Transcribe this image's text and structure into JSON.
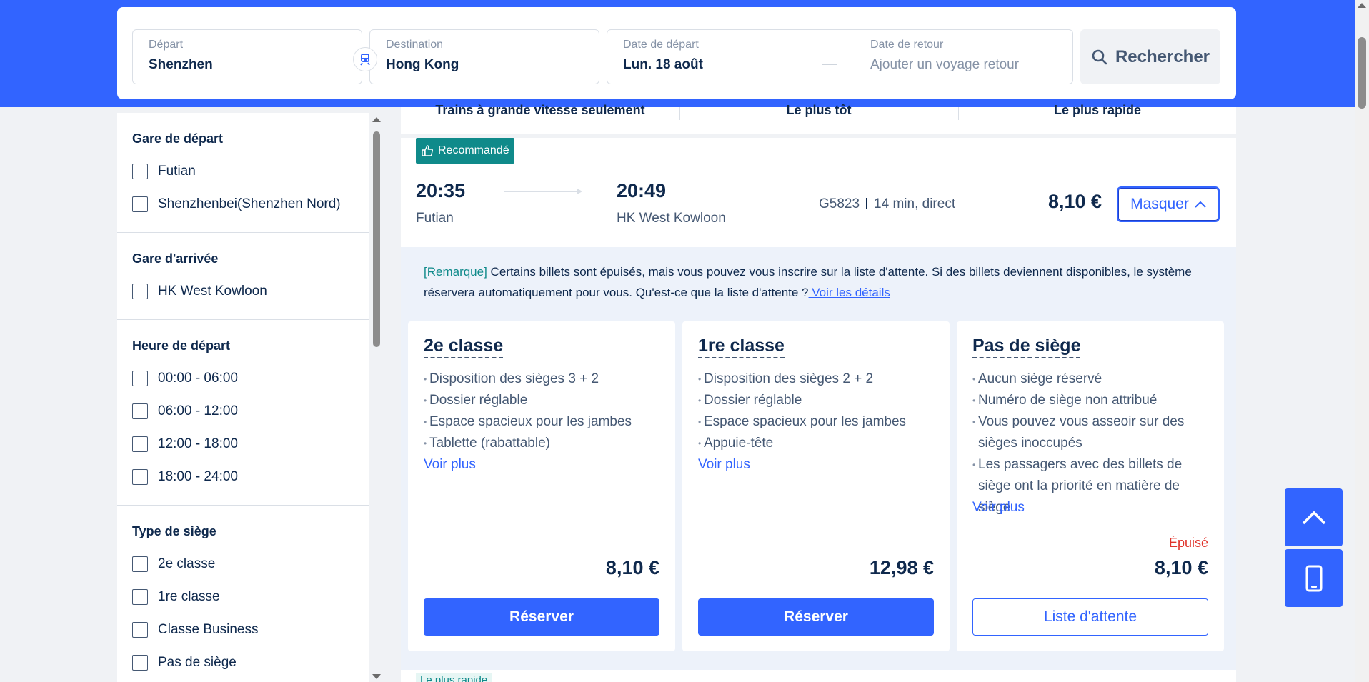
{
  "search": {
    "departure_label": "Départ",
    "departure_value": "Shenzhen",
    "destination_label": "Destination",
    "destination_value": "Hong Kong",
    "depart_date_label": "Date de départ",
    "depart_date_value": "Lun. 18 août",
    "return_date_label": "Date de retour",
    "return_date_placeholder": "Ajouter un voyage retour",
    "search_button": "Rechercher"
  },
  "sidebar": {
    "sections": [
      {
        "title": "Gare de départ",
        "options": [
          "Futian",
          "Shenzhenbei(Shenzhen Nord)"
        ]
      },
      {
        "title": "Gare d'arrivée",
        "options": [
          "HK West Kowloon"
        ]
      },
      {
        "title": "Heure de départ",
        "options": [
          "00:00 - 06:00",
          "06:00 - 12:00",
          "12:00 - 18:00",
          "18:00 - 24:00"
        ]
      },
      {
        "title": "Type de siège",
        "options": [
          "2e classe",
          "1re classe",
          "Classe Business",
          "Pas de siège"
        ]
      }
    ]
  },
  "sort": {
    "items": [
      "Trains à grande vitesse seulement",
      "Le plus tôt",
      "Le plus rapide"
    ]
  },
  "result": {
    "badge": "Recommandé",
    "dep_time": "20:35",
    "dep_station": "Futian",
    "arr_time": "20:49",
    "arr_station": "HK West Kowloon",
    "train_no": "G5823",
    "duration": "14 min, direct",
    "price": "8,10 €",
    "toggle_label": "Masquer",
    "remark_tag": "[Remarque]",
    "remark_text": " Certains billets sont épuisés, mais vous pouvez vous inscrire sur la liste d'attente. Si des billets deviennent disponibles, le système réservera automatiquement pour vous. Qu'est-ce que la liste d'attente ?",
    "remark_link": " Voir les détails",
    "classes": [
      {
        "name": "2e classe",
        "features": [
          "Disposition des sièges 3 + 2",
          "Dossier réglable",
          "Espace spacieux pour les jambes",
          "Tablette (rabattable)"
        ],
        "more": "Voir plus",
        "status": "",
        "price": "8,10 €",
        "action": "Réserver"
      },
      {
        "name": "1re classe",
        "features": [
          "Disposition des sièges 2 + 2",
          "Dossier réglable",
          "Espace spacieux pour les jambes",
          "Appuie-tête"
        ],
        "more": "Voir plus",
        "status": "",
        "price": "12,98 €",
        "action": "Réserver"
      },
      {
        "name": "Pas de siège",
        "features": [
          "Aucun siège réservé",
          "Numéro de siège non attribué",
          "Vous pouvez vous asseoir sur des sièges inoccupés",
          "Les passagers avec des billets de siège ont la priorité en matière de siège"
        ],
        "more": "Voir plus",
        "status": "Épuisé",
        "price": "8,10 €",
        "action": "Liste d'attente"
      }
    ]
  },
  "next_result": {
    "badge": "Le plus rapide"
  },
  "colors": {
    "brand": "#3264ff",
    "teal": "#0f8a8a",
    "sold_out": "#e0332b"
  },
  "icons": [
    "train-icon",
    "search-icon",
    "thumbs-up-icon",
    "chevron-up-icon",
    "scroll-top-icon",
    "mobile-icon"
  ]
}
